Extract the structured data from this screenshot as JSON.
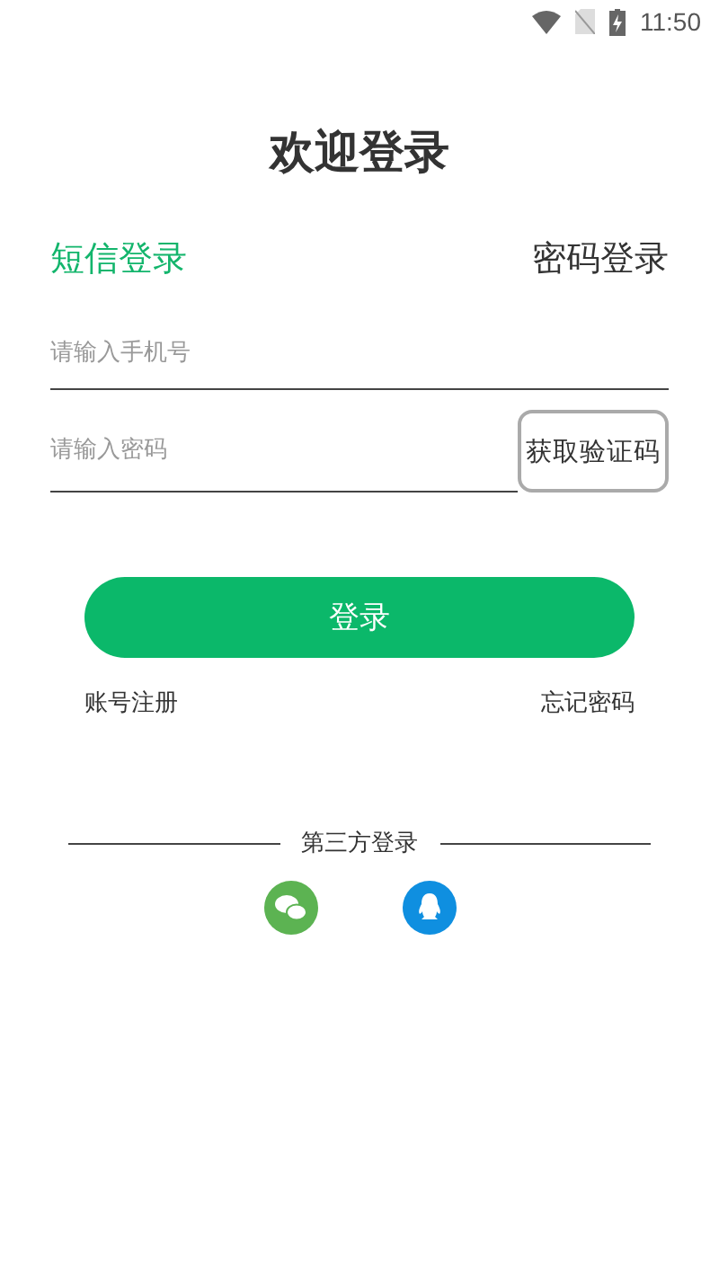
{
  "status_bar": {
    "time": "11:50"
  },
  "title": "欢迎登录",
  "tabs": [
    {
      "label": "短信登录",
      "selected": true
    },
    {
      "label": "密码登录",
      "selected": false
    }
  ],
  "phone_field": {
    "placeholder": "请输入手机号"
  },
  "password_field": {
    "placeholder": "请输入密码"
  },
  "code_button": "获取验证码",
  "login_button": "登录",
  "links": [
    "账号注册",
    "忘记密码"
  ],
  "third_party": {
    "label": "第三方登录",
    "options": [
      {
        "kind": "wechat"
      },
      {
        "kind": "qq"
      }
    ]
  }
}
